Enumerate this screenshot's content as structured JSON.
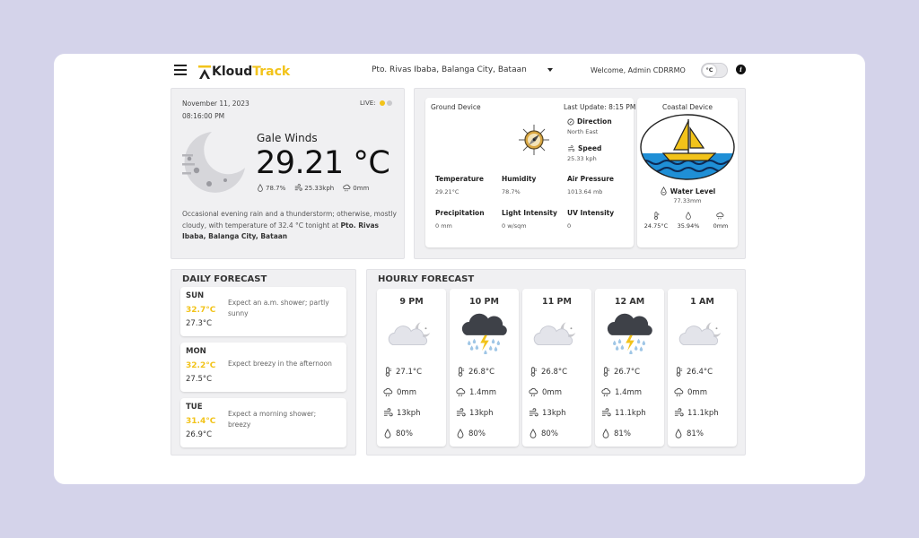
{
  "brand": {
    "name_part1": "Kloud",
    "name_part2": "Track",
    "accent": "#f2c31a"
  },
  "header": {
    "location": "Pto. Rivas Ibaba, Balanga City, Bataan",
    "welcome": "Welcome, Admin CDRRMO",
    "unit_toggle": "°C"
  },
  "current": {
    "date": "November 11, 2023",
    "time": "08:16:00 PM",
    "live_label": "LIVE:",
    "condition": "Gale Winds",
    "temperature": "29.21 °C",
    "humidity": "78.7%",
    "wind": "25.33kph",
    "rain": "0mm",
    "description": "Occasional evening rain and a thunderstorm; otherwise, mostly cloudy, with temperature of 32.4 °C tonight at",
    "description_place": "Pto. Rivas Ibaba, Balanga City, Bataan"
  },
  "ground_device": {
    "title": "Ground Device",
    "last_update": "Last Update: 8:15 PM",
    "direction_label": "Direction",
    "direction_value": "North East",
    "speed_label": "Speed",
    "speed_value": "25.33 kph",
    "metrics": [
      {
        "label": "Temperature",
        "value": "29.21°C"
      },
      {
        "label": "Humidity",
        "value": "78.7%"
      },
      {
        "label": "Air Pressure",
        "value": "1013.64 mb"
      },
      {
        "label": "Precipitation",
        "value": "0 mm"
      },
      {
        "label": "Light Intensity",
        "value": "0 w/sqm"
      },
      {
        "label": "UV Intensity",
        "value": "0"
      }
    ]
  },
  "coastal_device": {
    "title": "Coastal Device",
    "water_level_label": "Water Level",
    "water_level_value": "77.33mm",
    "temp": "24.75°C",
    "humidity": "35.94%",
    "rain": "0mm"
  },
  "daily": {
    "title": "DAILY FORECAST",
    "days": [
      {
        "day": "SUN",
        "high": "32.7°C",
        "low": "27.3°C",
        "desc": "Expect an a.m. shower; partly sunny"
      },
      {
        "day": "MON",
        "high": "32.2°C",
        "low": "27.5°C",
        "desc": "Expect breezy in the afternoon"
      },
      {
        "day": "TUE",
        "high": "31.4°C",
        "low": "26.9°C",
        "desc": "Expect a morning shower; breezy"
      }
    ]
  },
  "hourly": {
    "title": "HOURLY FORECAST",
    "hours": [
      {
        "time": "9 PM",
        "icon": "moon-cloud-icon",
        "temp": "27.1°C",
        "rain": "0mm",
        "wind": "13kph",
        "humidity": "80%"
      },
      {
        "time": "10 PM",
        "icon": "thunderstorm-icon",
        "temp": "26.8°C",
        "rain": "1.4mm",
        "wind": "13kph",
        "humidity": "80%"
      },
      {
        "time": "11 PM",
        "icon": "moon-cloud-icon",
        "temp": "26.8°C",
        "rain": "0mm",
        "wind": "13kph",
        "humidity": "80%"
      },
      {
        "time": "12 AM",
        "icon": "thunderstorm-icon",
        "temp": "26.7°C",
        "rain": "1.4mm",
        "wind": "11.1kph",
        "humidity": "81%"
      },
      {
        "time": "1 AM",
        "icon": "moon-cloud-icon",
        "temp": "26.4°C",
        "rain": "0mm",
        "wind": "11.1kph",
        "humidity": "81%"
      }
    ]
  }
}
